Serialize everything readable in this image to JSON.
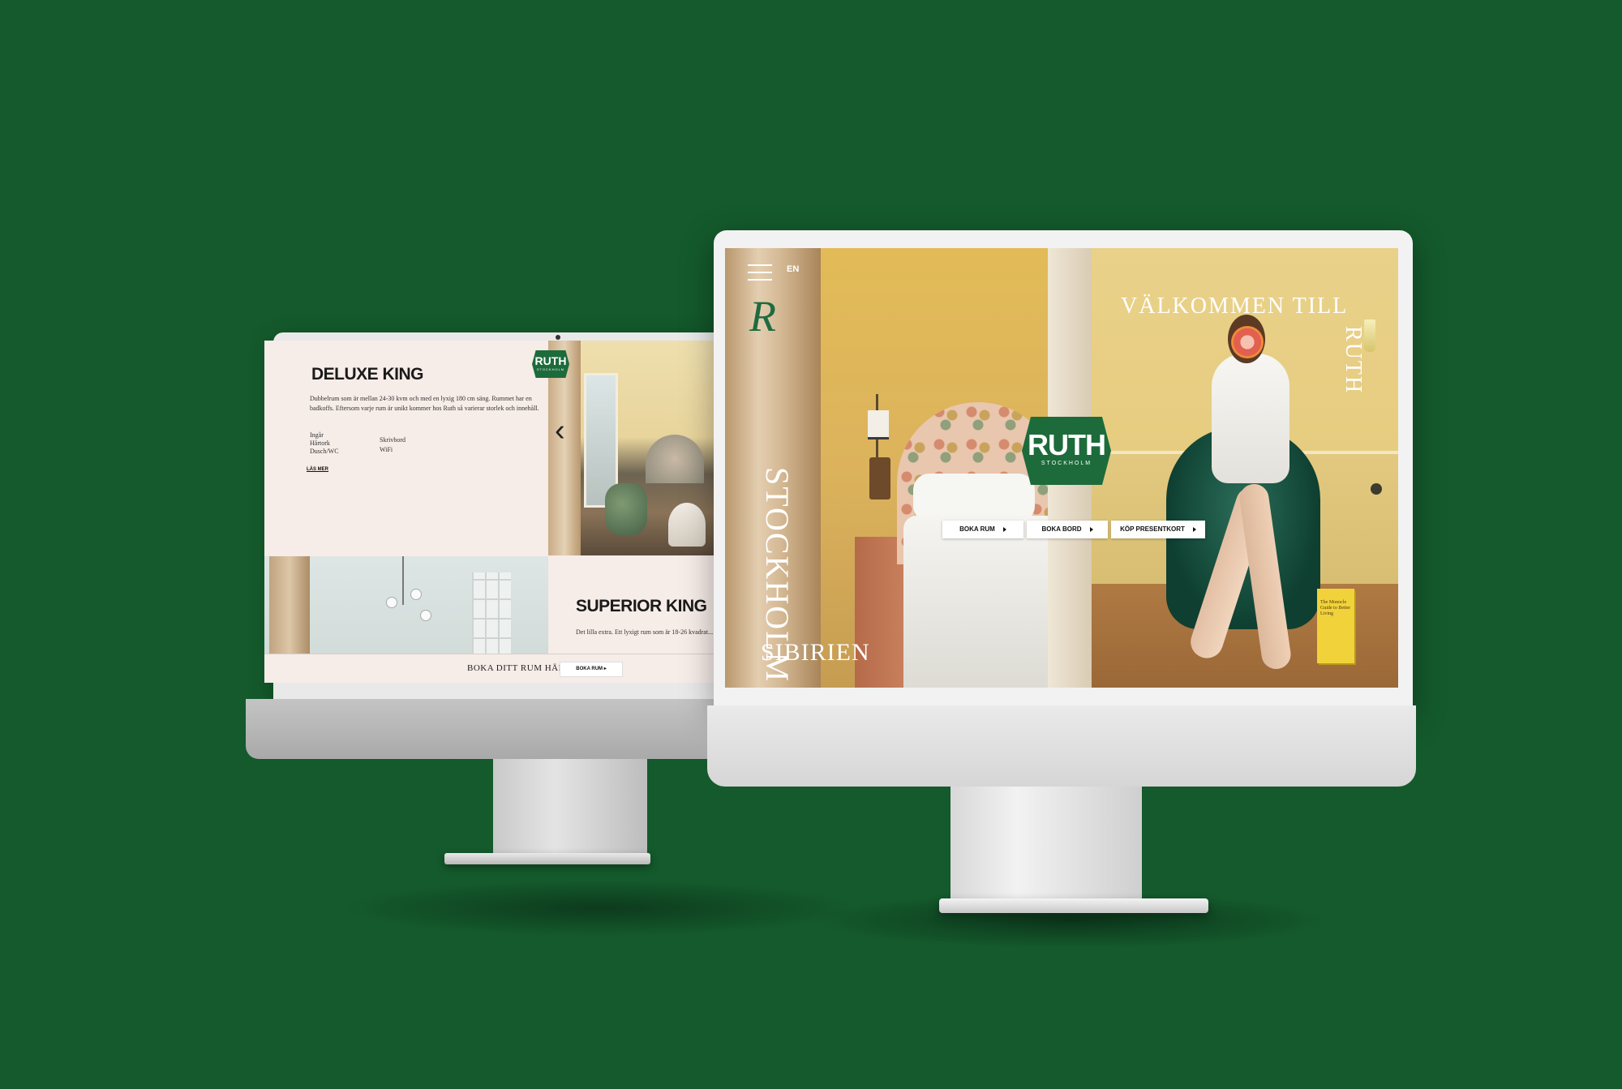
{
  "back_site": {
    "logo": {
      "name": "RUTH",
      "sub": "STOCKHOLM"
    },
    "room1": {
      "title": "DELUXE KING",
      "description": "Dubbelrum som är mellan 24-30 kvm och med en lyxig 180 cm säng. Rummet har en badkoffs. Eftersom varje rum är unikt kommer hos Ruth så varierar storlek och innehåll.",
      "amenities_col1": [
        "Ingår",
        "Hårtork",
        "Dusch/WC"
      ],
      "amenities_col2": [
        "Skrivbord",
        "WiFi"
      ],
      "read_more": "LÄS MER"
    },
    "room2": {
      "title": "SUPERIOR KING",
      "description": "Det lilla extra. Ett lyxigt rum som är 18-26 kvadrat... säng från Elite Sängar. Eftersom varje rum är unikt..."
    },
    "booking_bar": {
      "label": "BOKA DITT RUM HÄR",
      "button": "BOKA RUM"
    },
    "prev_arrow": "‹"
  },
  "front_site": {
    "language": "EN",
    "monogram": "R",
    "vertical_text": "STOCKHOLM",
    "sibirien": "SIBIRIEN",
    "welcome": "VÄLKOMMEN TILL",
    "welcome_name": "RUTH",
    "logo": {
      "name": "RUTH",
      "sub": "STOCKHOLM"
    },
    "buttons": [
      "BOKA RUM",
      "BOKA BORD",
      "KÖP PRESENTKORT"
    ],
    "book_spine": "The Monocle Guide to Better Living"
  },
  "colors": {
    "background": "#145a2c",
    "brand_green": "#1d6b3b"
  }
}
